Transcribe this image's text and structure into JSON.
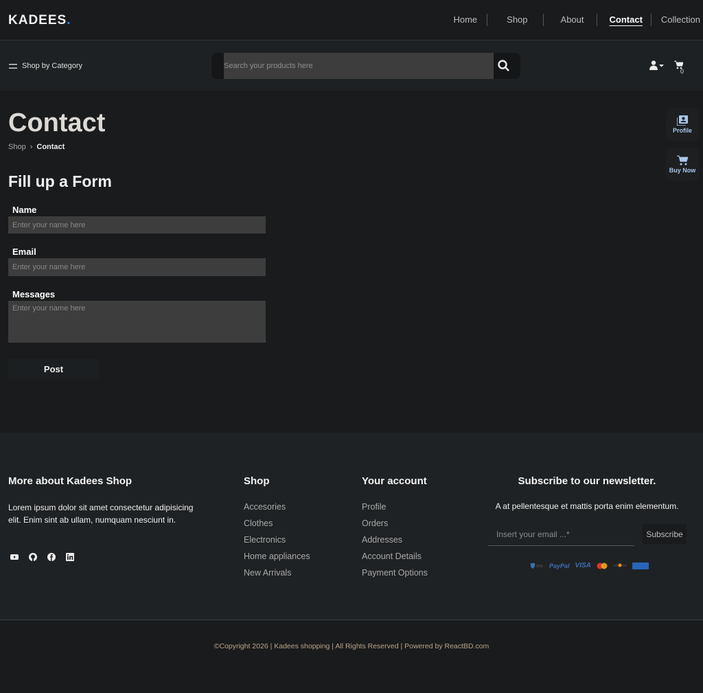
{
  "header": {
    "logo": "KADEES",
    "logo_dot": ".",
    "nav": [
      "Home",
      "Shop",
      "About",
      "Contact",
      "Collection"
    ],
    "active": "Contact"
  },
  "toolbar": {
    "category": "Shop by Category",
    "search_placeholder": "Search your products here",
    "cart_count": "0"
  },
  "page": {
    "title": "Contact",
    "breadcrumb": [
      "Shop",
      "Contact"
    ],
    "form_title": "Fill up a Form",
    "fields": [
      {
        "label": "Name",
        "placeholder": "Enter your name here"
      },
      {
        "label": "Email",
        "placeholder": "Enter your name here"
      },
      {
        "label": "Messages",
        "placeholder": "Enter your name here"
      }
    ],
    "post": "Post"
  },
  "side": {
    "profile": "Profile",
    "buy": "Buy Now"
  },
  "footer": {
    "about_title": "More about Kadees Shop",
    "about_text": "Lorem ipsum dolor sit amet consectetur adipisicing elit. Enim sint ab ullam, numquam nesciunt in.",
    "shop_title": "Shop",
    "shop_links": [
      "Accesories",
      "Clothes",
      "Electronics",
      "Home appliances",
      "New Arrivals"
    ],
    "account_title": "Your account",
    "account_links": [
      "Profile",
      "Orders",
      "Addresses",
      "Account Details",
      "Payment Options"
    ],
    "newsletter_title": "Subscribe to our newsletter.",
    "newsletter_text": "A at pellentesque et mattis porta enim elementum.",
    "email_placeholder": "Insert your email ...*",
    "subscribe": "Subscribe",
    "payments": [
      "PayPal",
      "VISA"
    ],
    "copyright": "©Copyright 2026 | Kadees shopping | All Rights Reserved | Powered by ReactBD.com"
  },
  "colors": {
    "accent": "#3b82f6",
    "side_text": "#a9c6ea"
  }
}
